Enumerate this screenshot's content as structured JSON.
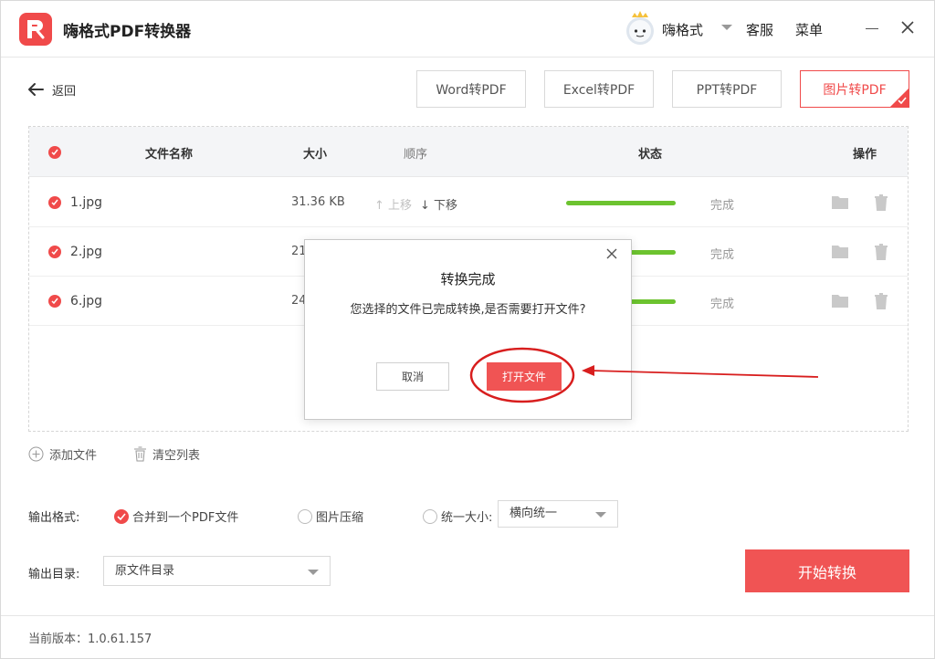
{
  "app": {
    "title": "嗨格式PDF转换器",
    "username": "嗨格式",
    "service_label": "客服",
    "menu_label": "菜单"
  },
  "toolbar": {
    "back_label": "返回",
    "tabs": [
      {
        "label": "Word转PDF",
        "active": false
      },
      {
        "label": "Excel转PDF",
        "active": false
      },
      {
        "label": "PPT转PDF",
        "active": false
      },
      {
        "label": "图片转PDF",
        "active": true
      }
    ]
  },
  "table": {
    "headers": {
      "name": "文件名称",
      "size": "大小",
      "order": "顺序",
      "status": "状态",
      "actions": "操作"
    },
    "order_up": "上移",
    "order_down": "下移",
    "rows": [
      {
        "name": "1.jpg",
        "size": "31.36 KB",
        "status": "完成",
        "progress": 1.0
      },
      {
        "name": "2.jpg",
        "size": "21",
        "status": "完成",
        "progress": 1.0
      },
      {
        "name": "6.jpg",
        "size": "24",
        "status": "完成",
        "progress": 1.0
      }
    ]
  },
  "actions": {
    "add_file": "添加文件",
    "clear_list": "清空列表"
  },
  "output": {
    "format_label": "输出格式:",
    "format_options": [
      {
        "label": "合并到一个PDF文件",
        "selected": true
      },
      {
        "label": "图片压缩",
        "selected": false
      },
      {
        "label": "统一大小:",
        "selected": false
      }
    ],
    "size_select_value": "横向统一",
    "dir_label": "输出目录:",
    "dir_select_value": "原文件目录"
  },
  "start_label": "开始转换",
  "footer": {
    "version": "当前版本：1.0.61.157"
  },
  "dialog": {
    "title": "转换完成",
    "message": "您选择的文件已完成转换,是否需要打开文件?",
    "cancel_label": "取消",
    "open_label": "打开文件"
  },
  "colors": {
    "accent": "#f04a4a",
    "progress": "#6cc32f",
    "annotation": "#d81e1e"
  },
  "icons": [
    "pdf-logo-icon",
    "snow-avatar-icon",
    "chevron-down-icon",
    "minimize-icon",
    "close-icon",
    "arrow-left-icon",
    "check-icon",
    "arrow-up-icon",
    "arrow-down-icon",
    "folder-icon",
    "trash-icon",
    "add-circle-icon"
  ]
}
